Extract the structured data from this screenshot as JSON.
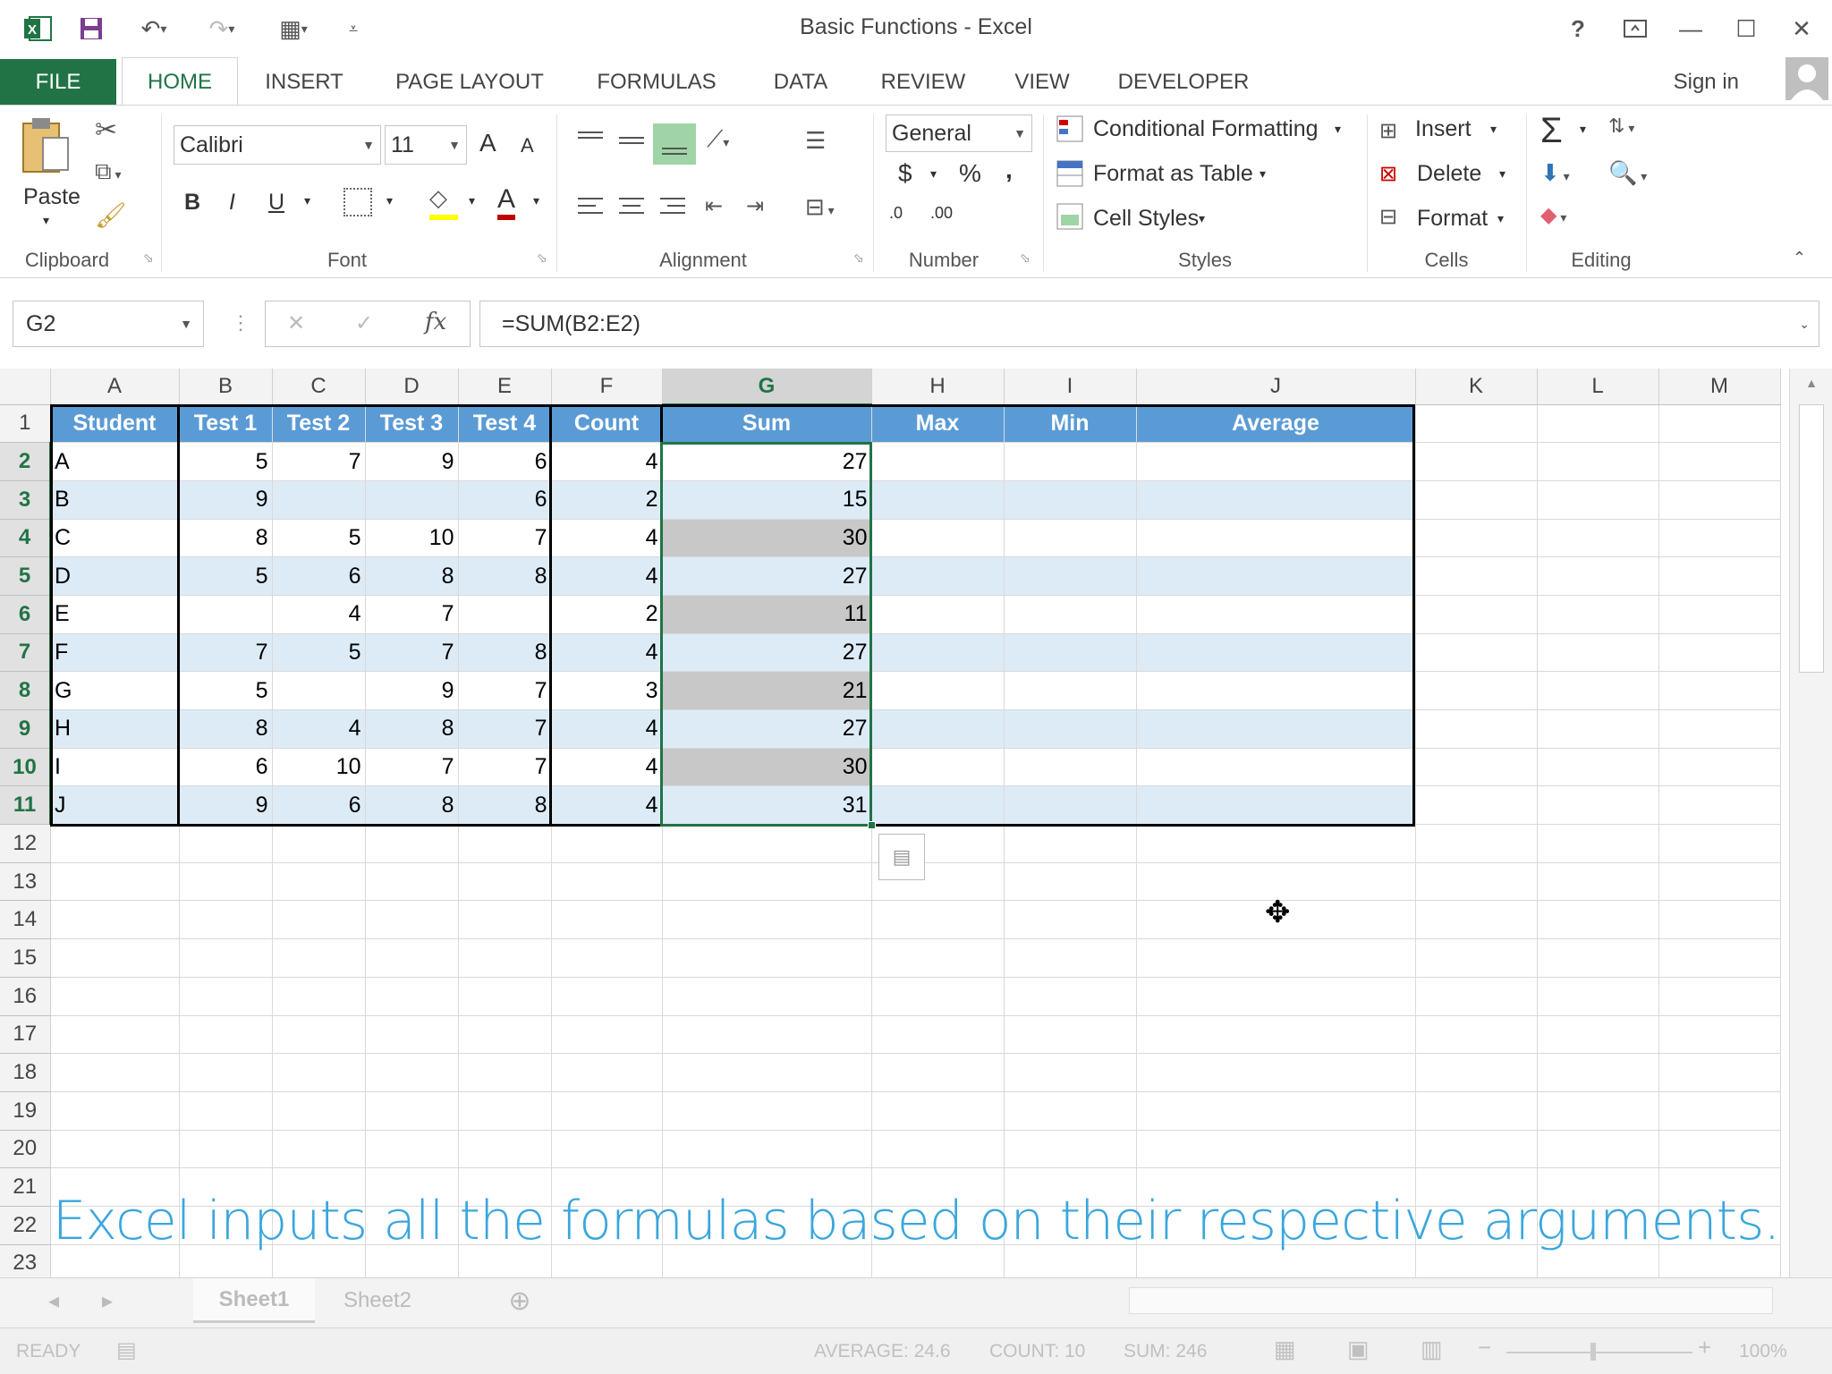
{
  "window": {
    "title": "Basic Functions - Excel"
  },
  "title_bar": {
    "help": "?",
    "minimize": "—",
    "maximize": "☐",
    "close": "✕"
  },
  "tabs": {
    "file": "FILE",
    "home": "HOME",
    "insert": "INSERT",
    "page_layout": "PAGE LAYOUT",
    "formulas": "FORMULAS",
    "data": "DATA",
    "review": "REVIEW",
    "view": "VIEW",
    "developer": "DEVELOPER",
    "sign_in": "Sign in"
  },
  "ribbon": {
    "clipboard": {
      "paste": "Paste",
      "label": "Clipboard"
    },
    "font": {
      "name": "Calibri",
      "size": "11",
      "bold": "B",
      "italic": "I",
      "underline": "U",
      "grow": "A",
      "shrink": "A",
      "font_color": "A",
      "label": "Font"
    },
    "alignment": {
      "label": "Alignment"
    },
    "number": {
      "format": "General",
      "currency": "$",
      "percent": "%",
      "comma": ",",
      "inc_decimal": ".0",
      "dec_decimal": ".00",
      "label": "Number"
    },
    "styles": {
      "conditional": "Conditional Formatting",
      "format_table": "Format as Table",
      "cell_styles": "Cell Styles",
      "label": "Styles"
    },
    "cells": {
      "insert": "Insert",
      "delete": "Delete",
      "format": "Format",
      "label": "Cells"
    },
    "editing": {
      "label": "Editing",
      "sum": "Σ"
    }
  },
  "formula_bar": {
    "name_box": "G2",
    "cancel": "✕",
    "enter": "✓",
    "fx": "fx",
    "formula": "=SUM(B2:E2)"
  },
  "columns": [
    "A",
    "B",
    "C",
    "D",
    "E",
    "F",
    "G",
    "H",
    "I",
    "J",
    "K",
    "L",
    "M"
  ],
  "rows": [
    "1",
    "2",
    "3",
    "4",
    "5",
    "6",
    "7",
    "8",
    "9",
    "10",
    "11",
    "12",
    "13",
    "14",
    "15",
    "16",
    "17",
    "18",
    "19",
    "20",
    "21",
    "22",
    "23"
  ],
  "table": {
    "headers": [
      "Student",
      "Test 1",
      "Test 2",
      "Test 3",
      "Test 4",
      "Count",
      "Sum",
      "Max",
      "Min",
      "Average"
    ],
    "data": [
      [
        "A",
        "5",
        "7",
        "9",
        "6",
        "4",
        "27"
      ],
      [
        "B",
        "9",
        "",
        "",
        "6",
        "2",
        "15"
      ],
      [
        "C",
        "8",
        "5",
        "10",
        "7",
        "4",
        "30"
      ],
      [
        "D",
        "5",
        "6",
        "8",
        "8",
        "4",
        "27"
      ],
      [
        "E",
        "",
        "4",
        "7",
        "",
        "2",
        "11"
      ],
      [
        "F",
        "7",
        "5",
        "7",
        "8",
        "4",
        "27"
      ],
      [
        "G",
        "5",
        "",
        "9",
        "7",
        "3",
        "21"
      ],
      [
        "H",
        "8",
        "4",
        "8",
        "7",
        "4",
        "27"
      ],
      [
        "I",
        "6",
        "10",
        "7",
        "7",
        "4",
        "30"
      ],
      [
        "J",
        "9",
        "6",
        "8",
        "8",
        "4",
        "31"
      ]
    ]
  },
  "caption": "Excel inputs all the formulas based on their respective arguments.",
  "sheets": [
    "Sheet1",
    "Sheet2"
  ],
  "status": {
    "mode": "READY",
    "average": "AVERAGE: 24.6",
    "count": "COUNT: 10",
    "sum": "SUM: 246",
    "zoom": "100%"
  },
  "colors": {
    "accent": "#217346",
    "table_header": "#5b9bd5",
    "band": "#ddebf7",
    "caption": "#3aa6dc"
  }
}
